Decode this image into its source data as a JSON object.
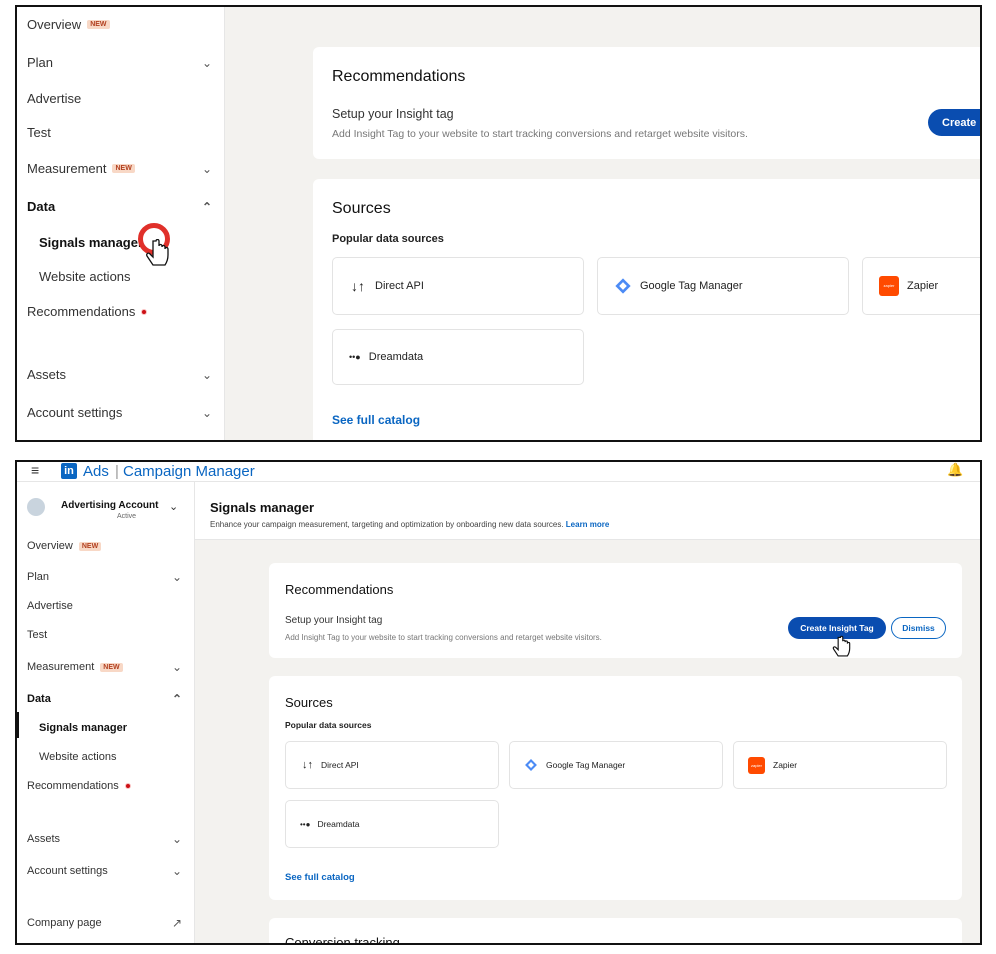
{
  "top": {
    "sidebar": [
      {
        "label": "Overview",
        "badge": "NEW"
      },
      {
        "label": "Plan"
      },
      {
        "label": "Advertise"
      },
      {
        "label": "Test"
      },
      {
        "label": "Measurement",
        "badge": "NEW"
      },
      {
        "label": "Data"
      },
      {
        "label": "Signals manager"
      },
      {
        "label": "Website actions"
      },
      {
        "label": "Recommendations"
      },
      {
        "label": "Assets"
      },
      {
        "label": "Account settings"
      }
    ],
    "recommendations_title": "Recommendations",
    "setup_title": "Setup your Insight tag",
    "setup_desc": "Add Insight Tag to your website to start tracking conversions and retarget website visitors.",
    "create_button": "Create I",
    "sources_title": "Sources",
    "popular": "Popular data sources",
    "sources": [
      "Direct API",
      "Google Tag Manager",
      "Zapier",
      "Dreamdata"
    ],
    "catalog": "See full catalog"
  },
  "bottom": {
    "app_logo": "in",
    "app_title": "Ads",
    "app_subtitle": "Campaign Manager",
    "account_name": "Advertising Account",
    "account_status": "Active",
    "page_title": "Signals manager",
    "page_desc": "Enhance your campaign measurement, targeting and optimization by onboarding new data sources.",
    "learn_more": "Learn more",
    "sidebar": [
      {
        "label": "Overview",
        "badge": "NEW"
      },
      {
        "label": "Plan"
      },
      {
        "label": "Advertise"
      },
      {
        "label": "Test"
      },
      {
        "label": "Measurement",
        "badge": "NEW"
      },
      {
        "label": "Data"
      },
      {
        "label": "Signals manager"
      },
      {
        "label": "Website actions"
      },
      {
        "label": "Recommendations"
      },
      {
        "label": "Assets"
      },
      {
        "label": "Account settings"
      },
      {
        "label": "Company page"
      }
    ],
    "recommendations_title": "Recommendations",
    "setup_title": "Setup your Insight tag",
    "setup_desc": "Add Insight Tag to your website to start tracking conversions and retarget website visitors.",
    "create_button": "Create Insight Tag",
    "dismiss_button": "Dismiss",
    "sources_title": "Sources",
    "popular": "Popular data sources",
    "sources": [
      "Direct API",
      "Google Tag Manager",
      "Zapier",
      "Dreamdata"
    ],
    "catalog": "See full catalog",
    "conversion_title": "Conversion tracking"
  },
  "colors": {
    "brand": "#0a66c2",
    "primary_button": "#0a4db0",
    "badge_bg": "#f8d8c6",
    "zapier": "#ff4a00",
    "notification": "#cc1016"
  },
  "icons": [
    "menu-icon",
    "linkedin-logo",
    "account-avatar",
    "chevron-down-icon",
    "chevron-up-icon",
    "external-link-icon",
    "direct-api-icon",
    "google-tag-manager-icon",
    "zapier-icon",
    "dreamdata-icon",
    "pointer-cursor-icon",
    "notification-bell-icon"
  ]
}
